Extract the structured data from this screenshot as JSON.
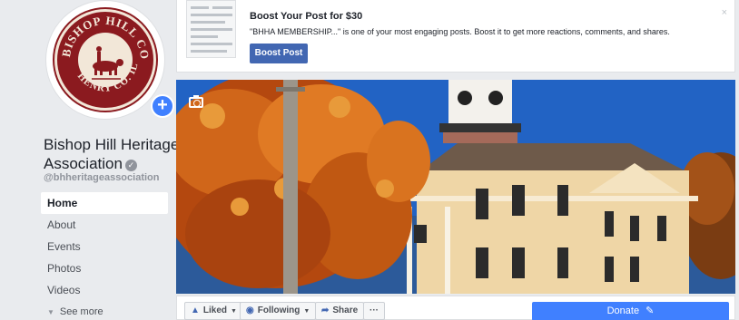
{
  "profile": {
    "name": "Bishop Hill Heritage Association",
    "handle": "@bhheritageassociation",
    "seal_text": "BISHOP HILL COLONY HENRY CO. ILL."
  },
  "nav": {
    "items": [
      {
        "label": "Home",
        "active": true
      },
      {
        "label": "About"
      },
      {
        "label": "Events"
      },
      {
        "label": "Photos"
      },
      {
        "label": "Videos"
      }
    ],
    "see_more": "See more"
  },
  "boost": {
    "title": "Boost Your Post for $30",
    "description": "\"BHHA MEMBERSHIP...\" is one of your most engaging posts. Boost it to get more reactions, comments, and shares.",
    "button": "Boost Post",
    "close": "×"
  },
  "actions": {
    "liked": "Liked",
    "following": "Following",
    "share": "Share",
    "more": "···",
    "donate": "Donate"
  },
  "icons": {
    "add": "plus-icon",
    "verified": "check-icon",
    "camera": "camera-icon",
    "thumb": "thumbs-up-icon",
    "rss": "rss-icon",
    "share": "share-arrow-icon",
    "pencil": "pencil-icon"
  },
  "colors": {
    "brand": "#4267b2",
    "accent": "#4080ff",
    "seal": "#8b1a1f",
    "foliage": "#d0661a",
    "sky": "#1f58b8"
  }
}
